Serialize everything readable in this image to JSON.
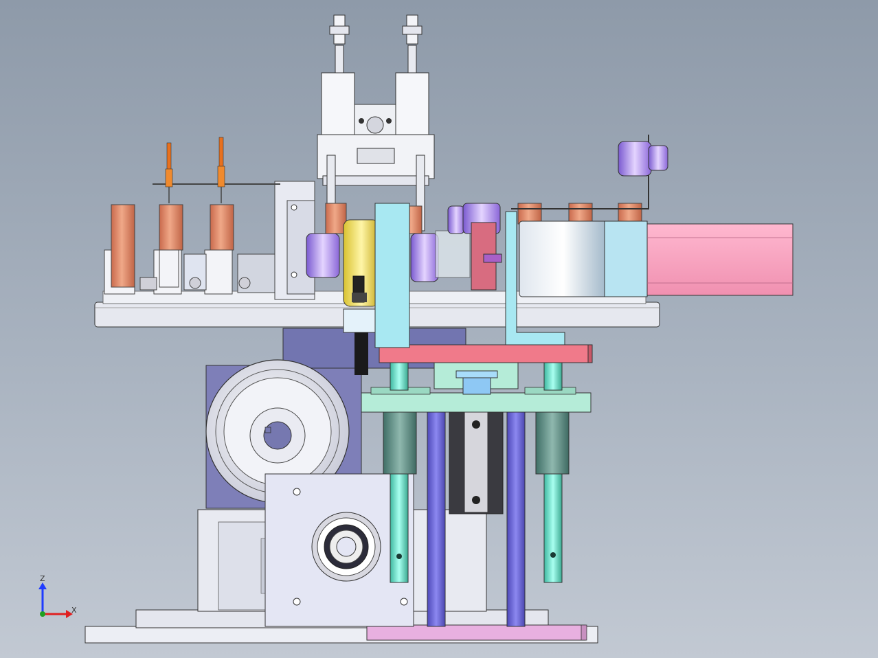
{
  "viewport": {
    "background_top": "#8e9aa9",
    "background_bottom": "#c2c9d3"
  },
  "triad": {
    "z_label": "Z",
    "x_label": "X",
    "z_color": "#1f3cff",
    "x_color": "#e02020",
    "origin_color": "#20a020"
  },
  "parts": {
    "turntable_color": "#e6e8ef",
    "copper_color": "#e08a6a",
    "servo_motor_color": "#f6a7c0",
    "top_plate_color": "#f07a8a",
    "base_plate_color": "#e8b0e0",
    "mid_plate_color": "#b5ecd8",
    "guide_rod_color": "#6ee8d0",
    "column_color": "#6a66d8",
    "gearbox_color": "#7e7fb8",
    "bracket_color": "#a8e8f2",
    "brass_hub_color": "#e8d84a",
    "purple_roller_color": "#b890e8",
    "pin_color": "#e8701e"
  }
}
